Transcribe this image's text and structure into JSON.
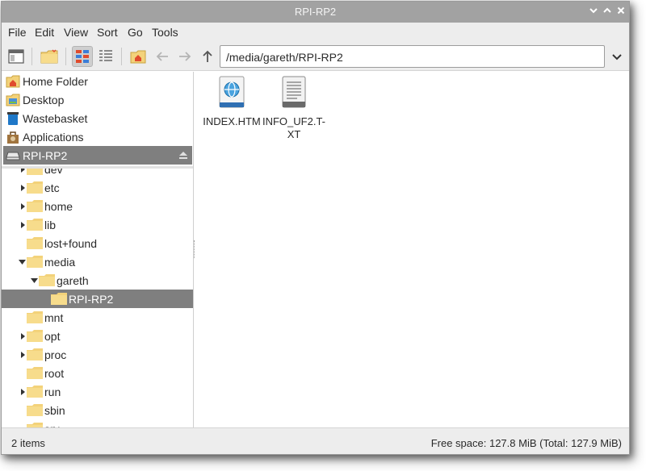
{
  "window": {
    "title": "RPI-RP2",
    "controls": {
      "minimize": "⌄",
      "maximize": "⌃",
      "close": "✕"
    }
  },
  "menubar": [
    "File",
    "Edit",
    "View",
    "Sort",
    "Go",
    "Tools"
  ],
  "toolbar": {
    "path": "/media/gareth/RPI-RP2",
    "icons": [
      "new-window-icon",
      "new-folder-icon",
      "icon-view-icon",
      "list-view-icon",
      "home-icon",
      "back-arrow-icon",
      "forward-arrow-icon",
      "up-arrow-icon",
      "chevron-down-icon"
    ]
  },
  "places": [
    {
      "label": "Home Folder",
      "icon": "home-folder-icon"
    },
    {
      "label": "Desktop",
      "icon": "desktop-icon"
    },
    {
      "label": "Wastebasket",
      "icon": "wastebasket-icon"
    },
    {
      "label": "Applications",
      "icon": "applications-icon"
    },
    {
      "label": "RPI-RP2",
      "icon": "drive-icon",
      "selected": true
    }
  ],
  "tree": [
    {
      "label": "dev",
      "expanded": false,
      "has_children": true
    },
    {
      "label": "etc",
      "expanded": false,
      "has_children": true
    },
    {
      "label": "home",
      "expanded": false,
      "has_children": true
    },
    {
      "label": "lib",
      "expanded": false,
      "has_children": true
    },
    {
      "label": "lost+found",
      "has_children": false
    },
    {
      "label": "media",
      "expanded": true,
      "has_children": true
    },
    {
      "label": "gareth",
      "expanded": true,
      "has_children": true
    },
    {
      "label": "RPI-RP2",
      "has_children": false,
      "selected": true
    },
    {
      "label": "mnt",
      "has_children": false
    },
    {
      "label": "opt",
      "expanded": false,
      "has_children": true
    },
    {
      "label": "proc",
      "expanded": false,
      "has_children": true
    },
    {
      "label": "root",
      "has_children": false
    },
    {
      "label": "run",
      "expanded": false,
      "has_children": true
    },
    {
      "label": "sbin",
      "has_children": false
    },
    {
      "label": "srv",
      "has_children": false
    }
  ],
  "files": [
    {
      "name": "INDEX.HTM",
      "icon": "html-file-icon"
    },
    {
      "name": "INFO_UF2.T-\nXT",
      "icon": "text-file-icon"
    }
  ],
  "status": {
    "items": "2 items",
    "free_space": "Free space: 127.8 MiB (Total: 127.9 MiB)"
  },
  "colors": {
    "titlebar": "#a2a2a2",
    "selection": "#7f7f7f",
    "folder": "#f6dc8f",
    "chrome": "#ededed"
  }
}
